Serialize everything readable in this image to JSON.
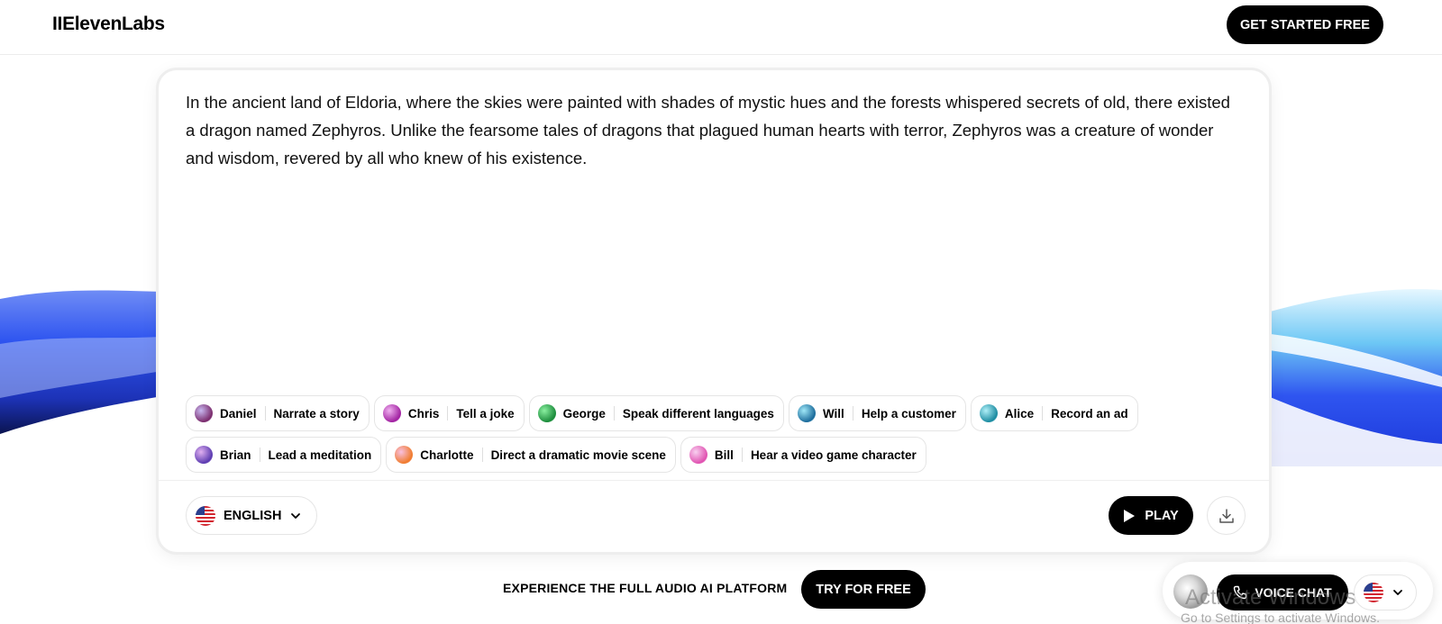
{
  "header": {
    "logo": "IIElevenLabs",
    "cta_label": "GET STARTED FREE"
  },
  "story": {
    "text": "In the ancient land of Eldoria, where the skies were painted with shades of mystic hues and the forests whispered secrets of old, there existed a dragon named Zephyros. Unlike the fearsome tales of dragons that plagued human hearts with terror, Zephyros was a creature of wonder and wisdom, revered by all who knew of his existence."
  },
  "voices": [
    {
      "name": "Daniel",
      "prompt": "Narrate a story",
      "colors": [
        "#7a2a6b",
        "#c8b8f0"
      ]
    },
    {
      "name": "Chris",
      "prompt": "Tell a joke",
      "colors": [
        "#a020a0",
        "#f0b0f0"
      ]
    },
    {
      "name": "George",
      "prompt": "Speak different languages",
      "colors": [
        "#1a8a3a",
        "#8af0a0"
      ]
    },
    {
      "name": "Will",
      "prompt": "Help a customer",
      "colors": [
        "#1a6a9a",
        "#a0e8f8"
      ]
    },
    {
      "name": "Alice",
      "prompt": "Record an ad",
      "colors": [
        "#1a8aa0",
        "#b0f0f8"
      ]
    },
    {
      "name": "Brian",
      "prompt": "Lead a meditation",
      "colors": [
        "#5a3ab0",
        "#e0b0f0"
      ]
    },
    {
      "name": "Charlotte",
      "prompt": "Direct a dramatic movie scene",
      "colors": [
        "#f07a2a",
        "#f8c0e0"
      ]
    },
    {
      "name": "Bill",
      "prompt": "Hear a video game character",
      "colors": [
        "#e050b0",
        "#f8d0f0"
      ]
    }
  ],
  "controls": {
    "language": "ENGLISH",
    "play_label": "PLAY",
    "download_icon": "download-icon"
  },
  "bottom": {
    "cta_text": "EXPERIENCE THE FULL AUDIO AI PLATFORM",
    "try_label": "TRY FOR FREE",
    "voice_chat_label": "VOICE CHAT"
  },
  "watermark": {
    "title": "Activate Windows",
    "subtitle": "Go to Settings to activate Windows."
  },
  "colors": {
    "accent": "#000000",
    "wave_blue": "#2f55f0",
    "border": "#e5e5e5"
  }
}
